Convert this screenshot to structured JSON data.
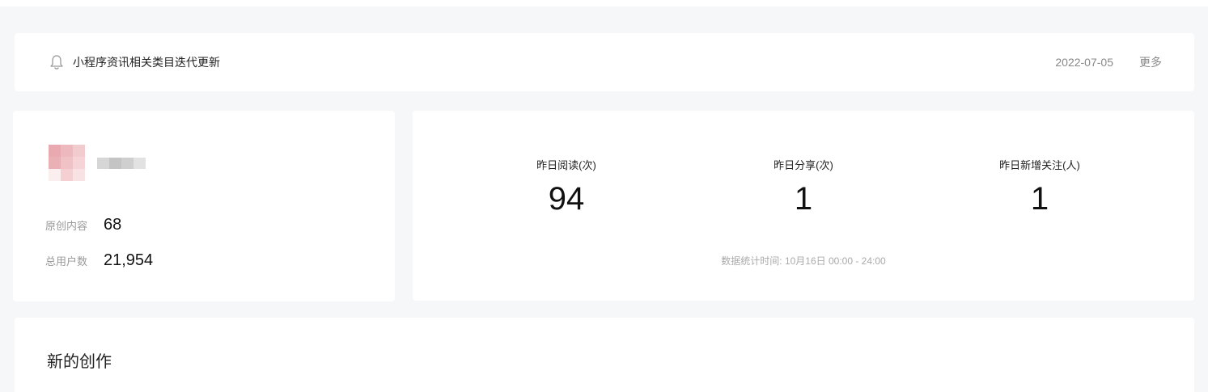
{
  "notice": {
    "icon": "bell-icon",
    "title": "小程序资讯相关类目迭代更新",
    "date": "2022-07-05",
    "more_label": "更多"
  },
  "profile": {
    "stats": [
      {
        "label": "原创内容",
        "value": "68"
      },
      {
        "label": "总用户数",
        "value": "21,954"
      }
    ]
  },
  "metrics": {
    "items": [
      {
        "label": "昨日阅读(次)",
        "value": "94"
      },
      {
        "label": "昨日分享(次)",
        "value": "1"
      },
      {
        "label": "昨日新增关注(人)",
        "value": "1"
      }
    ],
    "time_label": "数据统计时间: 10月16日 00:00 - 24:00"
  },
  "create": {
    "title": "新的创作"
  }
}
